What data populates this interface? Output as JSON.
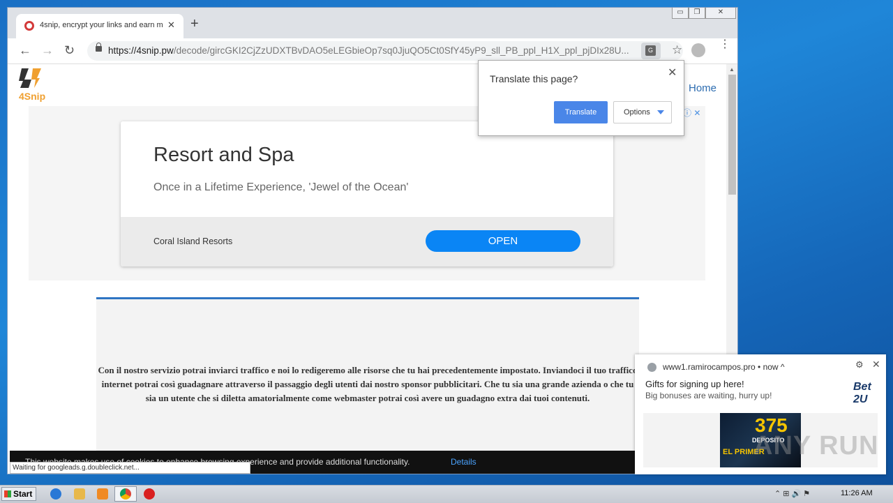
{
  "browser": {
    "tab_title": "4snip, encrypt your links and earn m",
    "tab_close": "✕",
    "new_tab": "+",
    "url_host": "https://4snip.pw",
    "url_path": "/decode/gircGKI2CjZzUDXTBvDAO5eLEGbieOp7sq0JjuQO5Ct0SfY45yP9_sll_PB_ppl_H1X_ppl_pjDIx28U...",
    "back_icon": "←",
    "forward_icon": "→",
    "reload_icon": "↻",
    "translate_icon": "G",
    "star_icon": "☆",
    "menu_icon": "⋮",
    "window_controls": [
      "▭",
      "❐",
      "✕"
    ]
  },
  "site": {
    "logo_text": "4Snip",
    "nav_home": "Home",
    "ad_icons": "ⓘ ✕",
    "ad": {
      "headline": "Resort and Spa",
      "subline": "Once in a Lifetime Experience, 'Jewel of the Ocean'",
      "advertiser": "Coral Island Resorts",
      "cta": "OPEN"
    },
    "body_text": "Con il nostro servizio potrai inviarci traffico e noi lo redigeremo alle risorse che tu hai precedentemente impostato. Inviandoci il tuo traffico internet potrai così guadagnare attraverso il passaggio degli utenti dai nostro sponsor pubblicitari. Che tu sia una grande azienda o che tu sia un utente che si diletta amatorialmente come webmaster potrai così avere un guadagno extra dai tuoi contenuti.",
    "cookie_msg": "This website makes use of cookies to enhance browsing experience and provide additional functionality.",
    "cookie_link": "Details",
    "status_text": "Waiting for googleads.g.doubleclick.net..."
  },
  "translate_bubble": {
    "question": "Translate this page?",
    "translate_btn": "Translate",
    "options_btn": "Options",
    "close": "✕"
  },
  "notification": {
    "source": "www1.ramirocampos.pro • now ^",
    "title": "Gifts for signing up here!",
    "body": "Big bonuses are waiting, hurry up!",
    "brand": "Bet 2U",
    "gear": "⚙",
    "close": "✕",
    "promo_big": "375",
    "promo_small": "DEPOSITO",
    "promo_bottom": "EL PRIMER",
    "watermark": "ANY RUN"
  },
  "taskbar": {
    "start": "Start",
    "tray_icons": "⌃ ⊞ 🔊 ⚑",
    "clock": "11:26 AM"
  }
}
